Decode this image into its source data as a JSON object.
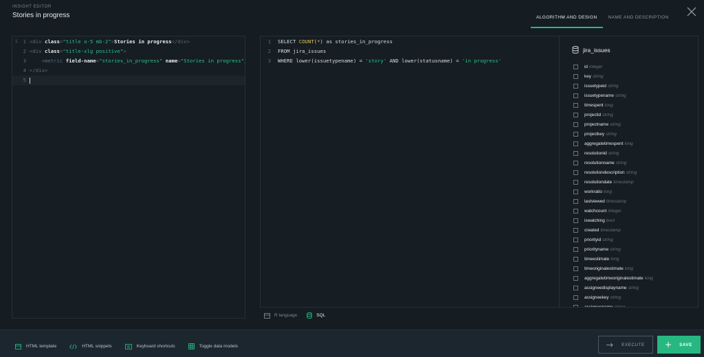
{
  "header": {
    "label": "INSIGHT EDITOR",
    "title": "Stories in progress",
    "tabs": [
      "ALGORITHM AND DESIGN",
      "NAME AND DESCRIPTION"
    ]
  },
  "html_editor": {
    "lines": [
      {
        "num": "1",
        "segments": [
          [
            "t-tag",
            "<div "
          ],
          [
            "t-attr",
            "class"
          ],
          [
            "t-tag",
            "="
          ],
          [
            "t-str",
            "\"title o-5 mb-2\""
          ],
          [
            "t-tag",
            ">"
          ],
          [
            "t-attr",
            "Stories in progress"
          ],
          [
            "t-tag",
            "</div>"
          ]
        ]
      },
      {
        "num": "2",
        "segments": [
          [
            "t-tag",
            "<div "
          ],
          [
            "t-attr",
            "class"
          ],
          [
            "t-tag",
            "="
          ],
          [
            "t-str",
            "\"title-xlg positive\""
          ],
          [
            "t-tag",
            ">"
          ]
        ]
      },
      {
        "num": "3",
        "segments": [
          [
            "t-tag",
            "    <metric "
          ],
          [
            "t-attr",
            "field-name"
          ],
          [
            "t-tag",
            "="
          ],
          [
            "t-str",
            "\"stories_in_progress\" "
          ],
          [
            "t-attr",
            "name"
          ],
          [
            "t-tag",
            "="
          ],
          [
            "t-str",
            "\"Stories in progress\"/>"
          ]
        ]
      },
      {
        "num": "4",
        "segments": [
          [
            "t-tag",
            "</div>"
          ]
        ]
      },
      {
        "num": "5",
        "segments": []
      }
    ]
  },
  "sql_editor": {
    "lines": [
      {
        "num": "1",
        "segments": [
          [
            "t-kw",
            "SELECT "
          ],
          [
            "t-fn",
            "COUNT"
          ],
          [
            "t-kw",
            "("
          ],
          [
            "t-fn",
            "*"
          ],
          [
            "t-kw",
            ") as stories_in_progress"
          ]
        ]
      },
      {
        "num": "2",
        "segments": [
          [
            "t-kw",
            "FROM jira_issues"
          ]
        ]
      },
      {
        "num": "3",
        "segments": [
          [
            "t-kw",
            "WHERE lower(issuetypename) = "
          ],
          [
            "t-str",
            "'story'"
          ],
          [
            "t-kw",
            " AND lower(statusname) = "
          ],
          [
            "t-str",
            "'in progress'"
          ]
        ]
      }
    ]
  },
  "schema": {
    "table": "jira_issues",
    "fields": [
      {
        "name": "id",
        "type": "integer"
      },
      {
        "name": "key",
        "type": "string"
      },
      {
        "name": "issuetypeid",
        "type": "string"
      },
      {
        "name": "issuetypename",
        "type": "string"
      },
      {
        "name": "timespent",
        "type": "long"
      },
      {
        "name": "projectid",
        "type": "string"
      },
      {
        "name": "projectname",
        "type": "string"
      },
      {
        "name": "projectkey",
        "type": "string"
      },
      {
        "name": "aggregatetimespent",
        "type": "long"
      },
      {
        "name": "resolutionid",
        "type": "string"
      },
      {
        "name": "resolutionname",
        "type": "string"
      },
      {
        "name": "resolutiondescription",
        "type": "string"
      },
      {
        "name": "resolutiondate",
        "type": "timestamp"
      },
      {
        "name": "workratio",
        "type": "long"
      },
      {
        "name": "lastviewed",
        "type": "timestamp"
      },
      {
        "name": "watchcount",
        "type": "integer"
      },
      {
        "name": "iswatching",
        "type": "bool"
      },
      {
        "name": "created",
        "type": "timestamp"
      },
      {
        "name": "priorityid",
        "type": "string"
      },
      {
        "name": "priorityname",
        "type": "string"
      },
      {
        "name": "timeestimate",
        "type": "long"
      },
      {
        "name": "timeoriginalestimate",
        "type": "long"
      },
      {
        "name": "aggregatetimeoriginalestimate",
        "type": "long"
      },
      {
        "name": "assigneedisplayname",
        "type": "string"
      },
      {
        "name": "assigneekey",
        "type": "string"
      },
      {
        "name": "assigneename",
        "type": "string"
      }
    ]
  },
  "language": {
    "options": [
      {
        "label": "R language",
        "icon": "r-language-icon"
      },
      {
        "label": "SQL",
        "icon": "database-icon"
      }
    ]
  },
  "footer": {
    "links": [
      {
        "label": "HTML template",
        "icon": "template-icon"
      },
      {
        "label": "HTML snippets",
        "icon": "code-icon"
      },
      {
        "label": "Keyboard shortcuts",
        "icon": "keyboard-icon"
      },
      {
        "label": "Toggle data models",
        "icon": "grid-icon"
      }
    ],
    "execute_label": "EXECUTE",
    "save_label": "SAVE"
  },
  "colors": {
    "accent": "#27b882",
    "background": "#151c22",
    "footer": "#1c262e",
    "string": "#29c18a",
    "function": "#e0c453"
  }
}
